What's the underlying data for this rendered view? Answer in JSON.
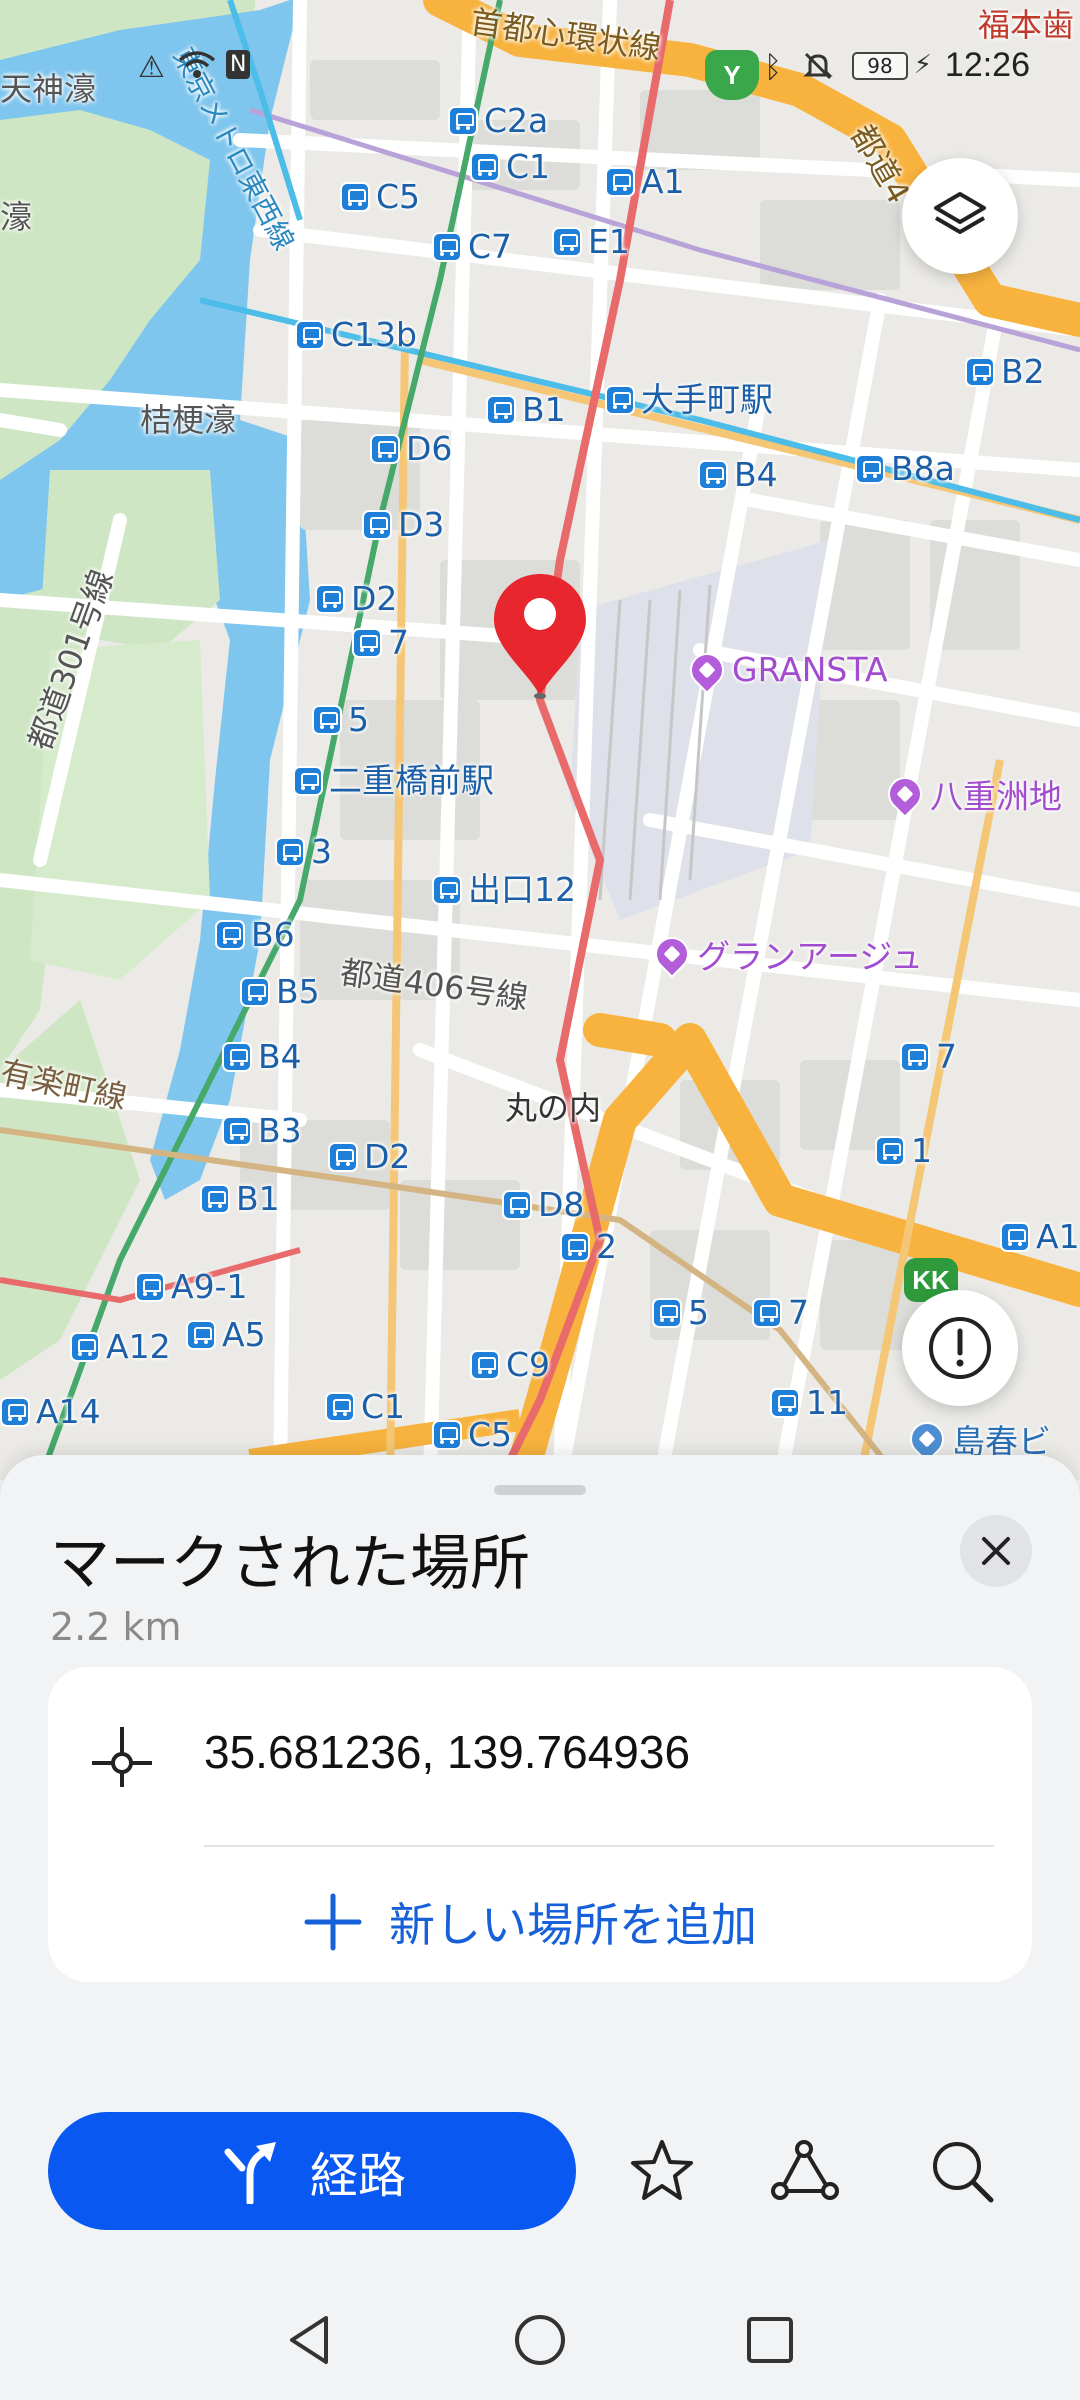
{
  "status_bar": {
    "time": "12:26",
    "battery": "98",
    "icons": [
      "alert-icon",
      "wifi-icon",
      "nfc-icon",
      "bluetooth-icon",
      "mute-icon",
      "charging-icon"
    ]
  },
  "map": {
    "area_labels": [
      "桔梗濠",
      "丸の内",
      "天神濠",
      "濠",
      "福本歯"
    ],
    "road_labels": [
      "都道301号線",
      "都道406号線",
      "首都心環状線",
      "有楽町線",
      "東京メトロ東西線",
      "都道4"
    ],
    "stations": [
      "C2a",
      "C1",
      "A1",
      "C5",
      "C7",
      "E1",
      "C13b",
      "B1",
      "大手町駅",
      "D6",
      "D3",
      "B4",
      "B8a",
      "D2",
      "7",
      "5",
      "二重橋前駅",
      "3",
      "出口12",
      "B6",
      "B5",
      "B4",
      "B3",
      "D2",
      "B1",
      "D8",
      "2",
      "A9-1",
      "A5",
      "A12",
      "C9",
      "A14",
      "C1",
      "C5",
      "5",
      "7",
      "11",
      "7",
      "1",
      "B2",
      "A1"
    ],
    "pois": [
      "GRANSTA",
      "八重洲地",
      "グランアージュ",
      "島春ビ"
    ],
    "badges": [
      "Y",
      "KK"
    ],
    "layers_icon": "layers-icon",
    "report_icon": "alert-circle-icon",
    "marker_icon": "location-pin-icon"
  },
  "sheet": {
    "title": "マークされた場所",
    "distance": "2.2 km",
    "coordinates": "35.681236, 139.764936",
    "add_place_label": "新しい場所を追加",
    "route_label": "経路",
    "action_icons": [
      "star-icon",
      "share-route-icon",
      "search-icon"
    ],
    "close_icon": "close-icon"
  },
  "colors": {
    "accent": "#0a58f2",
    "link": "#1660d9",
    "marker": "#e8262e",
    "bus_station": "#1e7fd9",
    "poi": "#b35ddb",
    "park": "#cfe6c4",
    "water": "#7fc6ee",
    "highway": "#f8b33e"
  },
  "nav": {
    "icons": [
      "back-icon",
      "home-icon",
      "recents-icon"
    ]
  }
}
